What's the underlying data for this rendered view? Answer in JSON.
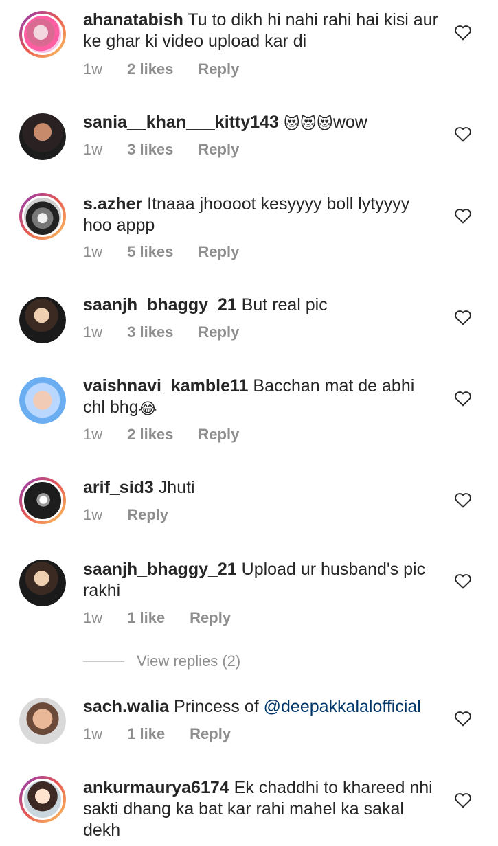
{
  "comments": [
    {
      "username": "ahanatabish",
      "text_before": "Tu to dikh hi nahi rahi hai kisi aur ke ghar ki video upload kar di",
      "time": "1w",
      "likes": "2 likes",
      "reply": "Reply"
    },
    {
      "username": "sania__khan___kitty143",
      "text_before": "",
      "emoji": "😻😻😻",
      "text_after": "wow",
      "time": "1w",
      "likes": "3 likes",
      "reply": "Reply"
    },
    {
      "username": "s.azher",
      "text_before": "Itnaaa jhoooot kesyyyy boll lytyyyy hoo appp",
      "time": "1w",
      "likes": "5 likes",
      "reply": "Reply"
    },
    {
      "username": "saanjh_bhaggy_21",
      "text_before": "But real pic",
      "time": "1w",
      "likes": "3 likes",
      "reply": "Reply"
    },
    {
      "username": "vaishnavi_kamble11",
      "text_before": "Bacchan mat de abhi chl bhg",
      "emoji": "😂",
      "time": "1w",
      "likes": "2 likes",
      "reply": "Reply"
    },
    {
      "username": "arif_sid3",
      "text_before": "Jhuti",
      "time": "1w",
      "likes": "",
      "reply": "Reply"
    },
    {
      "username": "saanjh_bhaggy_21",
      "text_before": "Upload ur husband's pic rakhi",
      "time": "1w",
      "likes": "1 like",
      "reply": "Reply"
    },
    {
      "username": "sach.walia",
      "text_before": "Princess of ",
      "mention": "@deepakkalalofficial",
      "time": "1w",
      "likes": "1 like",
      "reply": "Reply"
    },
    {
      "username": "ankurmaurya6174",
      "text_before": "Ek chaddhi to khareed nhi sakti dhang ka bat kar rahi mahel ka sakal dekh",
      "time": "",
      "likes": "",
      "reply": ""
    }
  ],
  "view_replies": "View replies (2)",
  "colors": {
    "text": "#262626",
    "muted": "#8e8e8e",
    "mention": "#003569"
  },
  "icons": {
    "like": "heart-outline-icon"
  }
}
